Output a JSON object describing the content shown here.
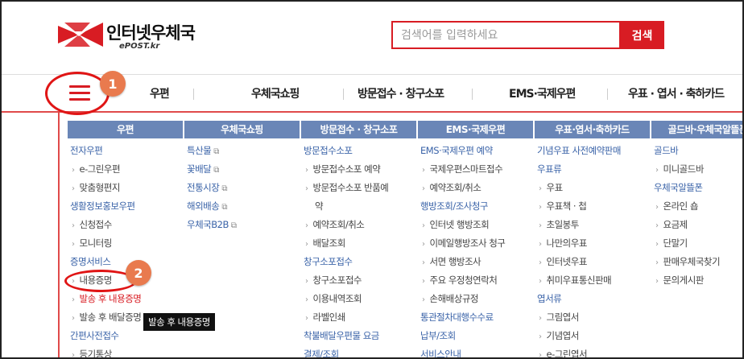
{
  "header": {
    "logo_text": "인터넷우체국",
    "logo_sub": "ePOST.kr",
    "search_placeholder": "검색어를 입력하세요",
    "search_button": "검색"
  },
  "nav": {
    "items": [
      "우편",
      "우체국쇼핑",
      "방문접수 · 창구소포",
      "EMS·국제우편",
      "우표 · 엽서 · 축하카드"
    ]
  },
  "menu": {
    "columns": [
      {
        "header": "우편",
        "items": [
          {
            "t": "h",
            "label": "전자우편"
          },
          {
            "t": "s",
            "label": "e-그린우편"
          },
          {
            "t": "s",
            "label": "맞춤형편지"
          },
          {
            "t": "h",
            "label": "생활정보홍보우편"
          },
          {
            "t": "s",
            "label": "신청접수"
          },
          {
            "t": "s",
            "label": "모니터링"
          },
          {
            "t": "h",
            "label": "증명서비스"
          },
          {
            "t": "s",
            "label": "내용증명"
          },
          {
            "t": "s",
            "label": "발송 후 내용증명",
            "red": true
          },
          {
            "t": "s",
            "label": "발송 후 배달증명"
          },
          {
            "t": "h",
            "label": "간편사전접수"
          },
          {
            "t": "s",
            "label": "등기통상"
          }
        ]
      },
      {
        "header": "우체국쇼핑",
        "items": [
          {
            "t": "l",
            "label": "특산물"
          },
          {
            "t": "l",
            "label": "꽃배달"
          },
          {
            "t": "l",
            "label": "전통시장"
          },
          {
            "t": "l",
            "label": "해외배송"
          },
          {
            "t": "l",
            "label": "우체국B2B"
          }
        ]
      },
      {
        "header": "방문접수 · 창구소포",
        "items": [
          {
            "t": "h",
            "label": "방문접수소포"
          },
          {
            "t": "s",
            "label": "방문접수소포 예약"
          },
          {
            "t": "s",
            "label": "방문접수소포 반품예"
          },
          {
            "t": "c",
            "label": "약"
          },
          {
            "t": "s",
            "label": "예약조회/취소"
          },
          {
            "t": "s",
            "label": "배달조회"
          },
          {
            "t": "h",
            "label": "창구소포접수"
          },
          {
            "t": "s",
            "label": "창구소포접수"
          },
          {
            "t": "s",
            "label": "이용내역조회"
          },
          {
            "t": "s",
            "label": "라벨인쇄"
          },
          {
            "t": "h",
            "label": "착불배달우편물 요금"
          },
          {
            "t": "h",
            "label": "결제/조회"
          }
        ]
      },
      {
        "header": "EMS·국제우편",
        "items": [
          {
            "t": "h",
            "label": "EMS·국제우편 예약"
          },
          {
            "t": "s",
            "label": "국제우편스마트접수"
          },
          {
            "t": "s",
            "label": "예약조회/취소"
          },
          {
            "t": "h",
            "label": "행방조회/조사청구"
          },
          {
            "t": "s",
            "label": "인터넷 행방조회"
          },
          {
            "t": "s",
            "label": "이메일행방조사 청구"
          },
          {
            "t": "s",
            "label": "서면 행방조사"
          },
          {
            "t": "s",
            "label": "주요 우정청연락처"
          },
          {
            "t": "s",
            "label": "손해배상규정"
          },
          {
            "t": "h",
            "label": "통관절차대행수수료"
          },
          {
            "t": "h",
            "label": "납부/조회"
          },
          {
            "t": "h",
            "label": "서비스안내"
          }
        ]
      },
      {
        "header": "우표·엽서·축하카드",
        "items": [
          {
            "t": "h",
            "label": "기념우표 사전예약판매"
          },
          {
            "t": "h",
            "label": "우표류"
          },
          {
            "t": "s",
            "label": "우표"
          },
          {
            "t": "s",
            "label": "우표책 · 첩"
          },
          {
            "t": "s",
            "label": "초일봉투"
          },
          {
            "t": "s",
            "label": "나만의우표"
          },
          {
            "t": "s",
            "label": "인터넷우표"
          },
          {
            "t": "s",
            "label": "취미우표통신판매"
          },
          {
            "t": "h",
            "label": "엽서류"
          },
          {
            "t": "s",
            "label": "그림엽서"
          },
          {
            "t": "s",
            "label": "기념엽서"
          },
          {
            "t": "s",
            "label": "e-그린엽서"
          }
        ]
      },
      {
        "header": "골드바·우체국알뜰폰",
        "items": [
          {
            "t": "h",
            "label": "골드바"
          },
          {
            "t": "s",
            "label": "미니골드바"
          },
          {
            "t": "h",
            "label": "우체국알뜰폰"
          },
          {
            "t": "s",
            "label": "온라인 숍"
          },
          {
            "t": "s",
            "label": "요금제"
          },
          {
            "t": "s",
            "label": "단말기"
          },
          {
            "t": "s",
            "label": "판매우체국찾기"
          },
          {
            "t": "s",
            "label": "문의게시판"
          }
        ]
      }
    ]
  },
  "annotations": {
    "badge1": "1",
    "badge2": "2",
    "tooltip": "발송 후 내용증명"
  },
  "colors": {
    "brand_red": "#d81c23",
    "menu_header": "#6a86b7",
    "link_blue": "#3a63a8",
    "badge": "#e97a4e"
  }
}
